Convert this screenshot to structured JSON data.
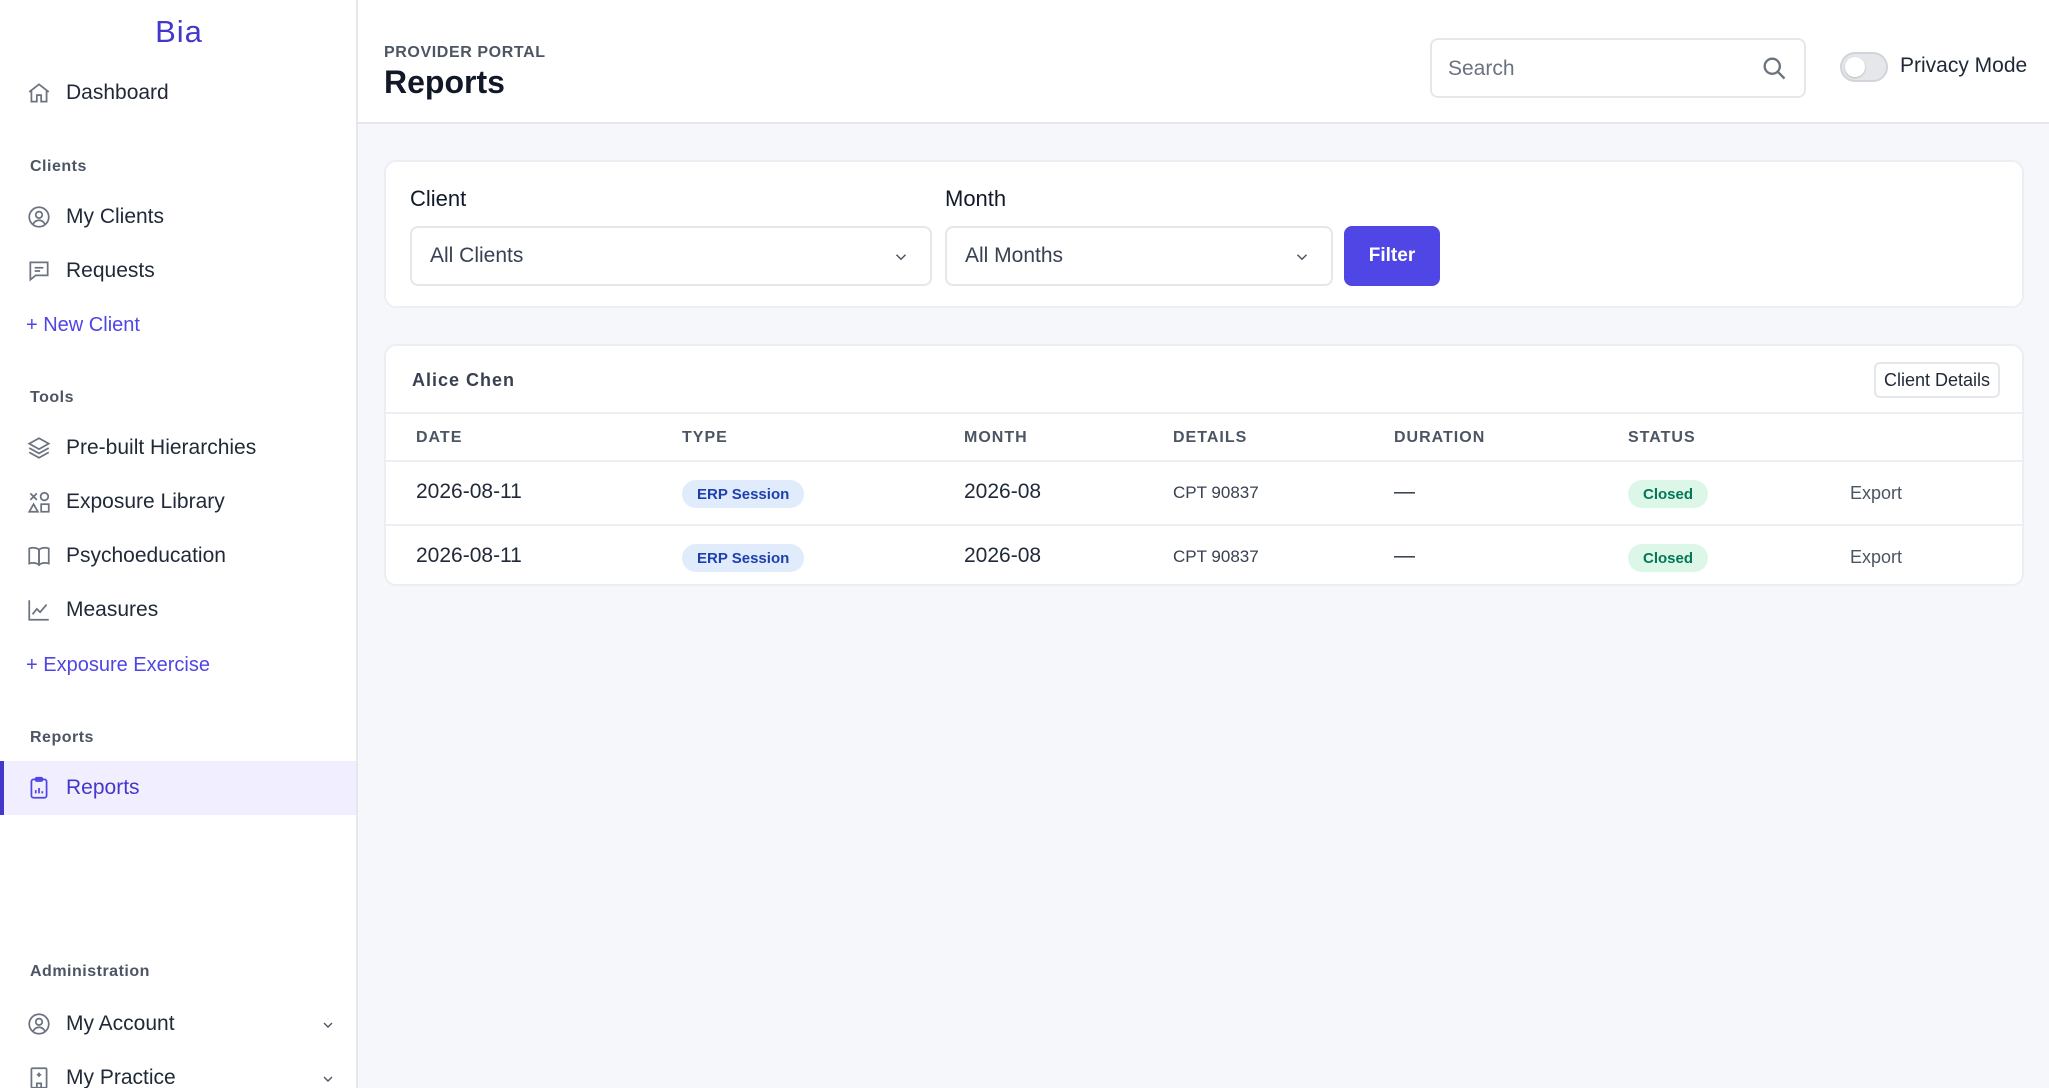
{
  "sidebar": {
    "brand": "Bia",
    "dashboard": "Dashboard",
    "sections": {
      "clients": "Clients",
      "tools": "Tools",
      "reports": "Reports",
      "administration": "Administration"
    },
    "clients_items": [
      "My Clients",
      "Requests"
    ],
    "new_client": "+ New Client",
    "tools_items": [
      "Pre-built Hierarchies",
      "Exposure Library",
      "Psychoeducation",
      "Measures"
    ],
    "new_exposure": "+ Exposure Exercise",
    "reports_item": "Reports",
    "admin_items": [
      "My Account",
      "My Practice"
    ]
  },
  "header": {
    "portal_label": "PROVIDER PORTAL",
    "title": "Reports",
    "search_placeholder": "Search",
    "privacy_label": "Privacy Mode",
    "privacy_on": false
  },
  "filters": {
    "client_label": "Client",
    "client_value": "All Clients",
    "month_label": "Month",
    "month_value": "All Months",
    "filter_button": "Filter"
  },
  "report": {
    "client_name": "Alice Chen",
    "client_details_button": "Client Details",
    "columns": [
      "DATE",
      "TYPE",
      "MONTH",
      "DETAILS",
      "DURATION",
      "STATUS"
    ],
    "rows": [
      {
        "date": "2026-08-11",
        "type": "ERP Session",
        "month": "2026-08",
        "details": "CPT 90837",
        "duration": "—",
        "status": "Closed",
        "action": "Export"
      },
      {
        "date": "2026-08-11",
        "type": "ERP Session",
        "month": "2026-08",
        "details": "CPT 90837",
        "duration": "—",
        "status": "Closed",
        "action": "Export"
      }
    ]
  },
  "colors": {
    "accent": "#4f46e5",
    "brand": "#4338ca",
    "status_closed_bg": "#dcf6e7",
    "status_closed_text": "#047857",
    "type_badge_bg": "#e0ecfb"
  }
}
